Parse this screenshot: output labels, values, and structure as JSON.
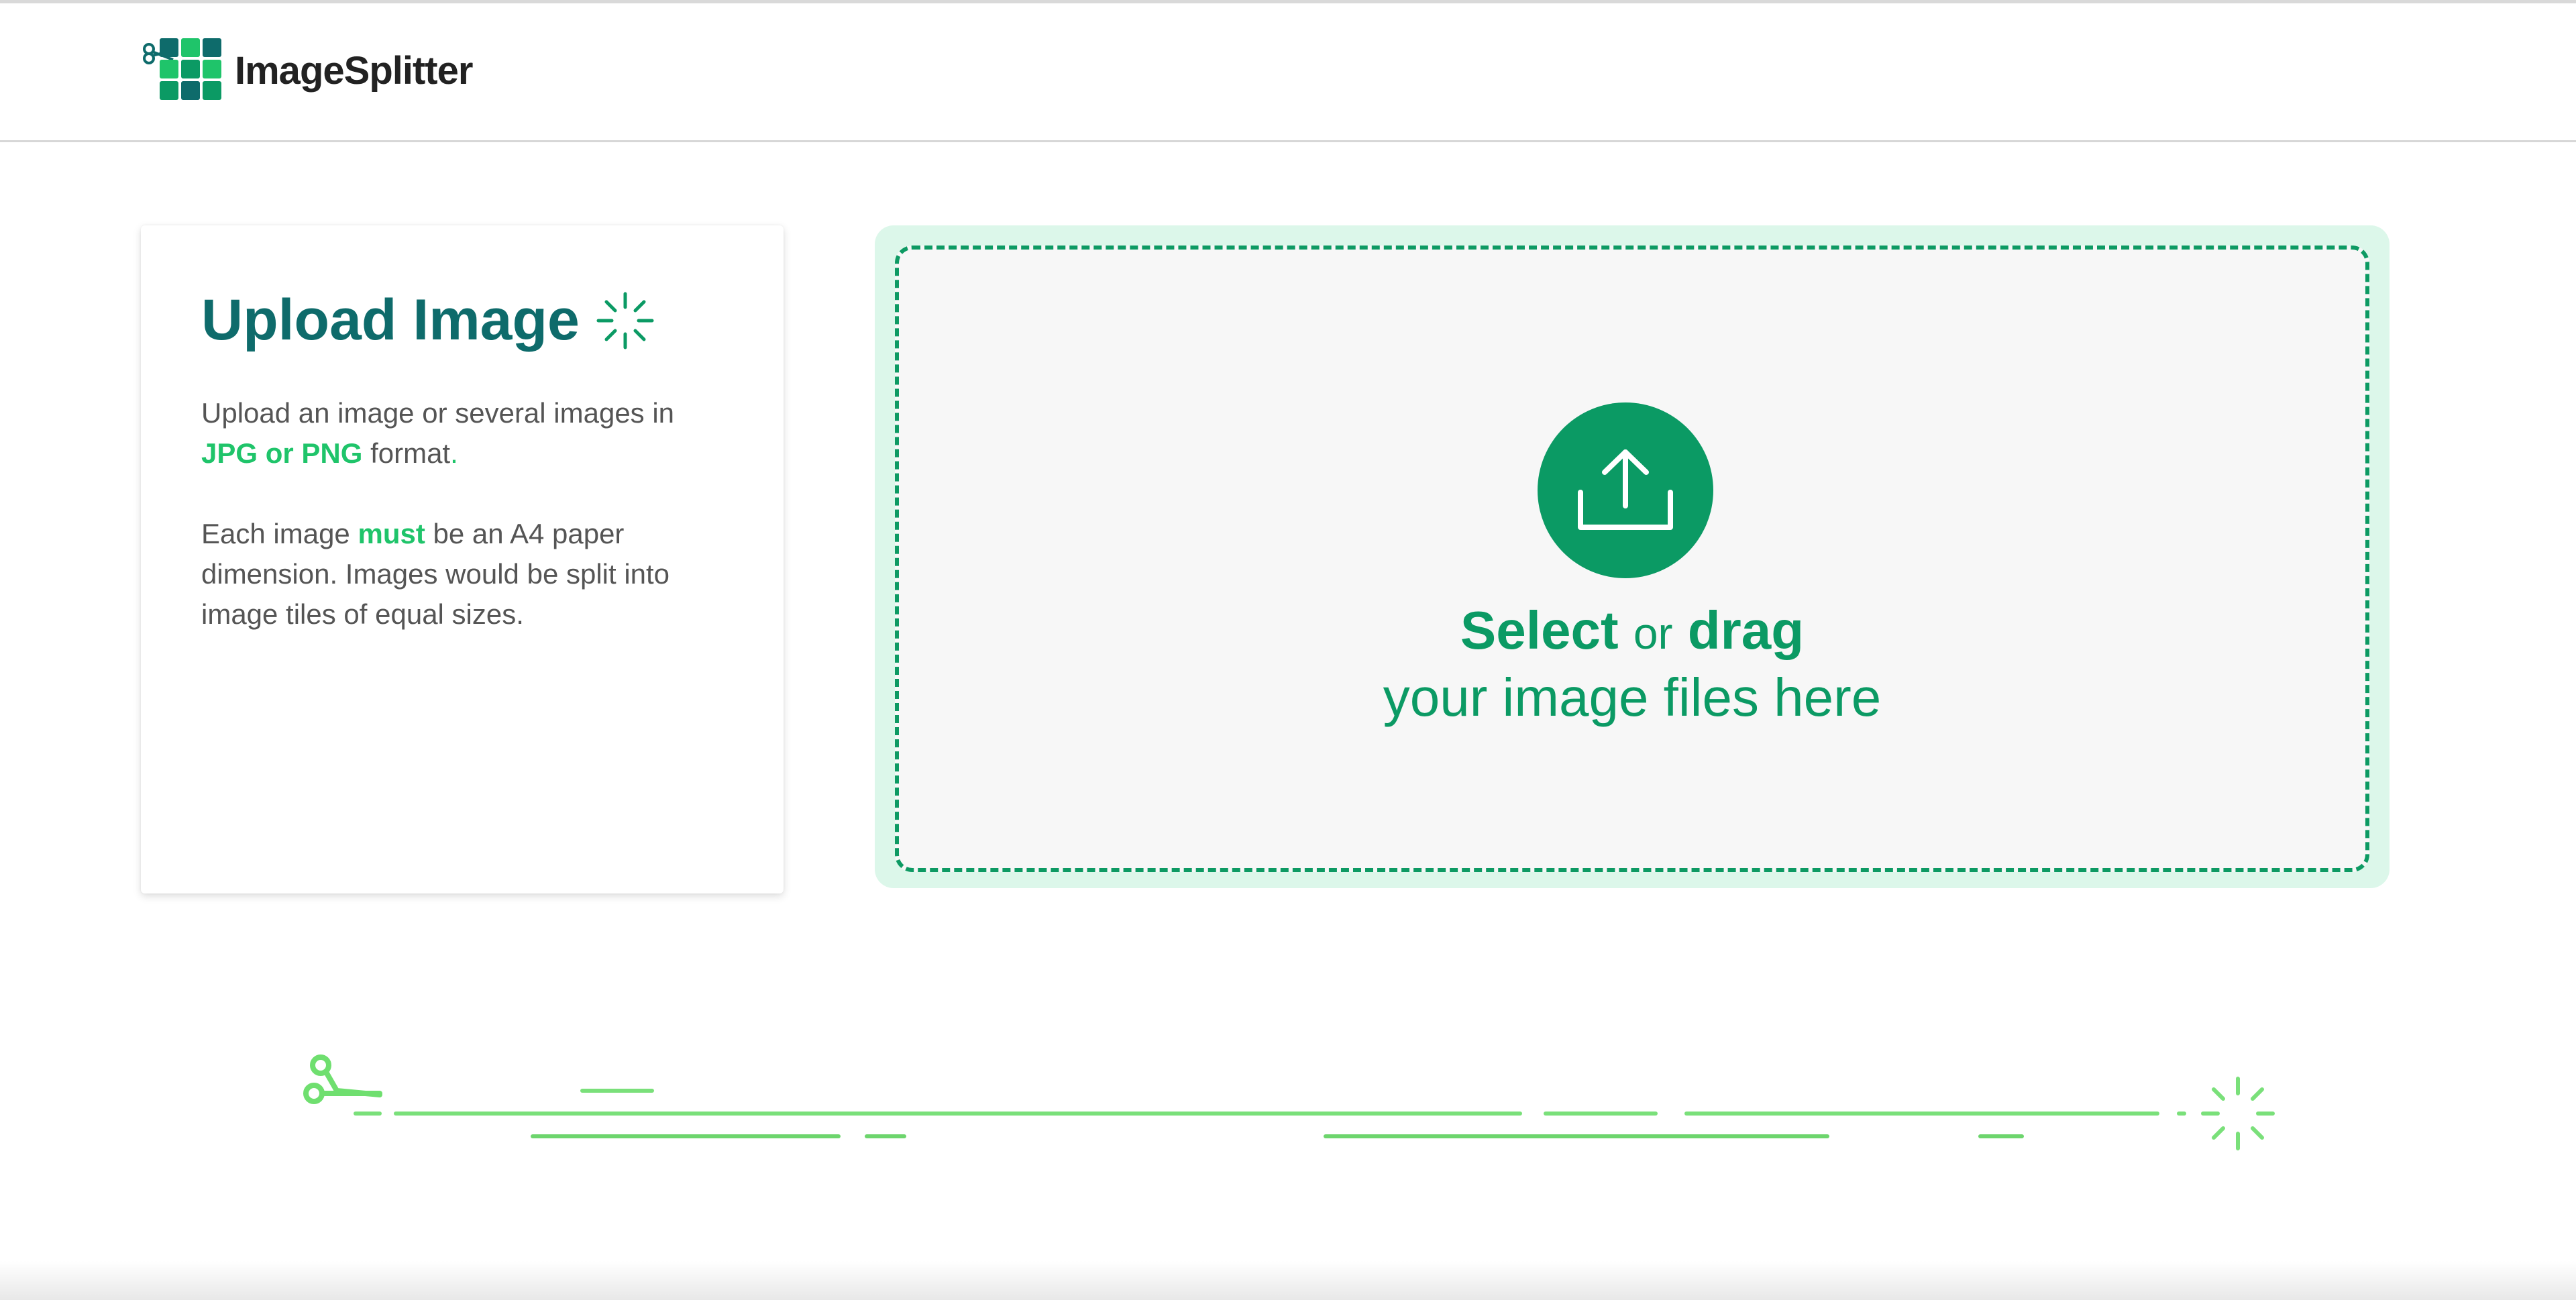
{
  "brand": {
    "name": "ImageSplitter",
    "logo_icon": "scissors-grid-logo-icon",
    "colors": {
      "dark": "#0e6b6b",
      "green": "#1fc46a",
      "teal": "#0b9a64"
    }
  },
  "info": {
    "title": "Upload Image",
    "title_icon": "sparkle-icon",
    "p1_before": "Upload an image or several images in",
    "p1_highlight": "JPG or PNG",
    "p1_after": " format",
    "p1_end": ".",
    "p2_before": "Each image ",
    "p2_highlight": "must",
    "p2_after": " be an A4 paper dimension. Images would be split into image tiles of equal sizes."
  },
  "dropzone": {
    "icon": "upload-icon",
    "select": "Select",
    "or": "or",
    "drag": "drag",
    "subtitle": "your image files here"
  },
  "decoration": {
    "left_icon": "scissors-icon",
    "right_icon": "sparkle-icon"
  }
}
